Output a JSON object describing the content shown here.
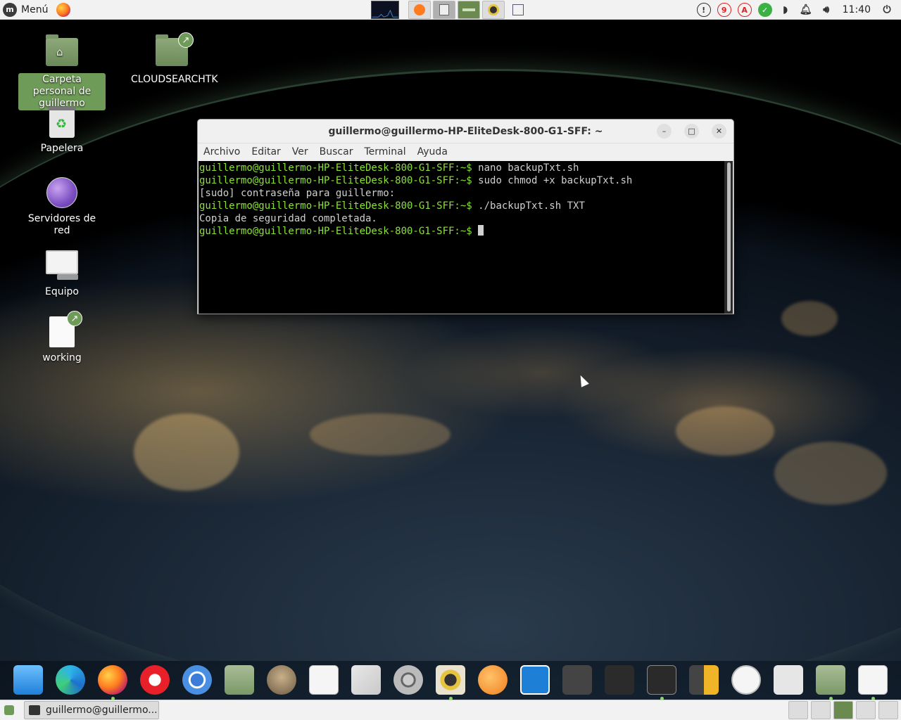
{
  "top_panel": {
    "menu_label": "Menú",
    "tray": {
      "notification_count": "9",
      "clock": "11:40"
    }
  },
  "desktop_icons": [
    {
      "label": "Carpeta personal de guillermo",
      "icon": "home-folder-icon"
    },
    {
      "label": "CLOUDSEARCHTK",
      "icon": "folder-link-icon"
    },
    {
      "label": "Papelera",
      "icon": "trash-icon"
    },
    {
      "label": "Servidores de red",
      "icon": "network-servers-icon"
    },
    {
      "label": "Equipo",
      "icon": "computer-icon"
    },
    {
      "label": "working",
      "icon": "document-link-icon"
    }
  ],
  "terminal": {
    "title": "guillermo@guillermo-HP-EliteDesk-800-G1-SFF: ~",
    "menu": [
      "Archivo",
      "Editar",
      "Ver",
      "Buscar",
      "Terminal",
      "Ayuda"
    ],
    "prompt": "guillermo@guillermo-HP-EliteDesk-800-G1-SFF:~$",
    "lines": [
      {
        "prompt": "guillermo@guillermo-HP-EliteDesk-800-G1-SFF:~$",
        "text": " nano backupTxt.sh"
      },
      {
        "prompt": "guillermo@guillermo-HP-EliteDesk-800-G1-SFF:~$",
        "text": " sudo chmod +x backupTxt.sh"
      },
      {
        "prompt": "",
        "text": "[sudo] contraseña para guillermo:"
      },
      {
        "prompt": "guillermo@guillermo-HP-EliteDesk-800-G1-SFF:~$",
        "text": " ./backupTxt.sh TXT"
      },
      {
        "prompt": "",
        "text": "Copia de seguridad completada."
      },
      {
        "prompt": "guillermo@guillermo-HP-EliteDesk-800-G1-SFF:~$",
        "text": " "
      }
    ]
  },
  "taskbar": {
    "window_label": "guillermo@guillermo..."
  },
  "colors": {
    "prompt_green": "#8ae234",
    "accent": "#6e9b57"
  }
}
